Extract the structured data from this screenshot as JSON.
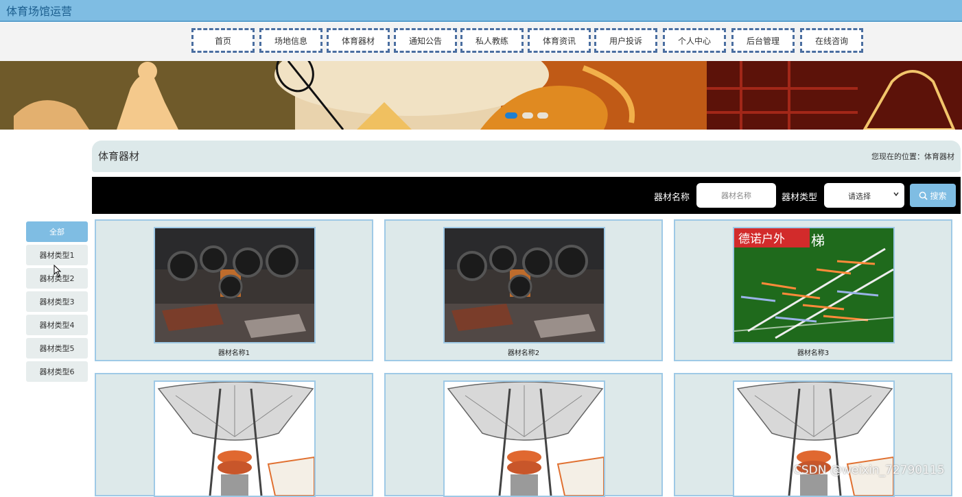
{
  "app": {
    "title": "体育场馆运营"
  },
  "nav": {
    "items": [
      "首页",
      "场地信息",
      "体育器材",
      "通知公告",
      "私人教练",
      "体育资讯",
      "用户投诉",
      "个人中心",
      "后台管理",
      "在线咨询"
    ]
  },
  "banner": {
    "dots": 3,
    "active_dot": 1
  },
  "page": {
    "title": "体育器材",
    "breadcrumb": "您现在的位置：体育器材"
  },
  "search": {
    "name_label": "器材名称",
    "name_placeholder": "器材名称",
    "type_label": "器材类型",
    "type_selected": "请选择",
    "button_label": "搜索"
  },
  "sidebar": {
    "items": [
      {
        "label": "全部",
        "active": true
      },
      {
        "label": "器材类型1",
        "active": false
      },
      {
        "label": "器材类型2",
        "active": false
      },
      {
        "label": "器材类型3",
        "active": false
      },
      {
        "label": "器材类型4",
        "active": false
      },
      {
        "label": "器材类型5",
        "active": false
      },
      {
        "label": "器材类型6",
        "active": false
      }
    ]
  },
  "products": [
    {
      "name": "器材名称1",
      "image": "gym-tires"
    },
    {
      "name": "器材名称2",
      "image": "gym-tires"
    },
    {
      "name": "器材名称3",
      "image": "agility-ladder",
      "overlay_text": "德诺户外",
      "overlay_char": "梯"
    },
    {
      "name": "",
      "image": "ball-machine"
    },
    {
      "name": "",
      "image": "ball-machine"
    },
    {
      "name": "",
      "image": "ball-machine"
    }
  ],
  "watermark": "CSDN @weixin_72790115",
  "colors": {
    "accent": "#7fbde3",
    "panel": "#dde9ea",
    "nav_border": "#4a6ea0"
  }
}
